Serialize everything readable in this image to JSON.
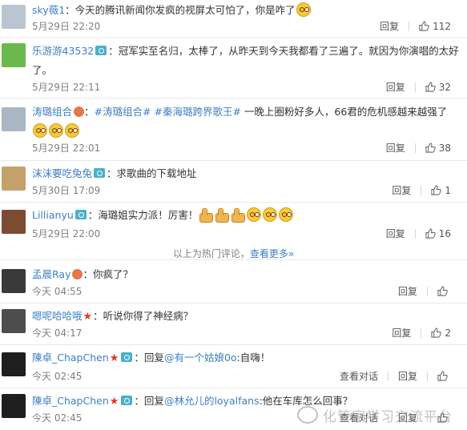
{
  "comments": [
    {
      "name": "sky薇1",
      "badges": [],
      "text_parts": [
        {
          "t": "：今天的腾讯新闻你发疯的视屏太可怕了，你是咋了"
        }
      ],
      "emoji_count": 1,
      "time": "5月29日 22:20",
      "reply": "回复",
      "likes": "112",
      "avatar_color": "#b9c6d2"
    },
    {
      "name": "乐游游43532",
      "badges": [
        "v"
      ],
      "text_parts": [
        {
          "t": "：冠军实至名归，太棒了，从昨天到今天我都看了三遍了。就因为你演唱的太好了。"
        }
      ],
      "emoji_count": 0,
      "time": "5月29日 22:11",
      "reply": "回复",
      "likes": "32",
      "avatar_color": "#6bb84d"
    },
    {
      "name": "涛璐组合",
      "badges": [
        "lv"
      ],
      "text_parts": [
        {
          "t": "："
        },
        {
          "t": "#涛璐组合#",
          "c": "topic"
        },
        {
          "t": " "
        },
        {
          "t": "#秦海璐跨界歌王#",
          "c": "topic"
        },
        {
          "t": " 一晚上圈粉好多人，66君的危机感越来越强了"
        }
      ],
      "emoji_count": 3,
      "time": "5月29日 22:01",
      "reply": "回复",
      "likes": "38",
      "avatar_color": "#a9b7c4"
    },
    {
      "name": "沫沫要吃兔兔",
      "badges": [
        "v"
      ],
      "text_parts": [
        {
          "t": "：求歌曲的下载地址"
        }
      ],
      "emoji_count": 0,
      "time": "5月30日 17:09",
      "reply": "回复",
      "likes": "1",
      "avatar_color": "#c4a06a"
    },
    {
      "name": "Lillianyu",
      "badges": [
        "v"
      ],
      "text_parts": [
        {
          "t": "：海璐姐实力派！厉害！"
        }
      ],
      "emoji_count": 3,
      "thumb_count": 3,
      "time": "5月29日 22:00",
      "reply": "回复",
      "likes": "16",
      "avatar_color": "#7d4a32"
    }
  ],
  "hot_separator": {
    "text": "以上为热门评论，",
    "more": "查看更多»"
  },
  "recent": [
    {
      "name": "孟晨Ray",
      "badges": [
        "lv"
      ],
      "text": "：你疯了？",
      "time": "今天 04:55",
      "reply": "回复",
      "likes": "",
      "avatar_color": "#3a3a3a"
    },
    {
      "name": "嗯呢哈哈哦",
      "badges": [
        "star"
      ],
      "text": "：听说你得了神经病？",
      "time": "今天 04:17",
      "reply": "回复",
      "likes": "2",
      "avatar_color": "#4d4d4d"
    },
    {
      "name": "陳卓_ChapChen",
      "badges": [
        "star",
        "v"
      ],
      "text_pre": "：回复",
      "mention": "@有一个姑娘0o",
      "text_post": ":自嗨！",
      "time": "今天 02:45",
      "view_thread": "查看对话",
      "reply": "回复",
      "likes": "",
      "avatar_color": "#1e1e1e"
    },
    {
      "name": "陳卓_ChapChen",
      "badges": [
        "star",
        "v"
      ],
      "text_pre": "：回复",
      "mention": "@林允儿的loyalfans",
      "text_post": ":他在车库怎么回事？",
      "time": "今天 02:45",
      "view_thread": "查看对话",
      "reply": "回复",
      "likes": "",
      "avatar_color": "#1e1e1e"
    }
  ],
  "watermark": "化管家学习交流平台",
  "colors": {
    "link": "#3e7fc5",
    "meta": "#808080",
    "star": "#e0392b",
    "vbadge": "#49b0c8"
  }
}
